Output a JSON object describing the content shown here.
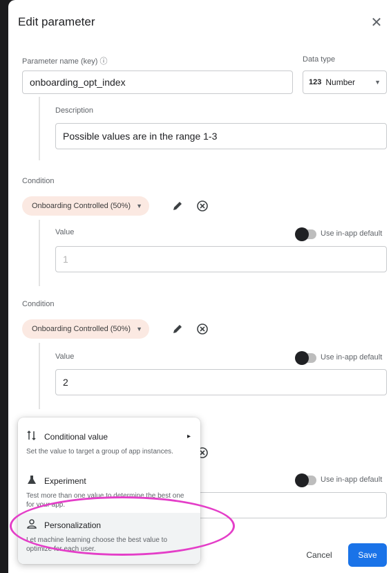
{
  "dialog": {
    "title": "Edit parameter",
    "close_icon": "close-icon"
  },
  "parameter": {
    "key_label": "Parameter name (key)",
    "key_value": "onboarding_opt_index",
    "data_type_label": "Data type",
    "data_type_value": "Number",
    "description_label": "Description",
    "description_value": "Possible values are in the range 1-3"
  },
  "conditions": [
    {
      "label": "Condition",
      "chip": "Onboarding Controlled (50%)",
      "value_label": "Value",
      "value": "1",
      "value_placeholder_style": "disabled",
      "toggle_label": "Use in-app default"
    },
    {
      "label": "Condition",
      "chip": "Onboarding Controlled (50%)",
      "value_label": "Value",
      "value": "2",
      "toggle_label": "Use in-app default"
    }
  ],
  "third_toggle_label": "Use in-app default",
  "menu": {
    "items": [
      {
        "icon": "conditional-value-icon",
        "title": "Conditional value",
        "desc": "Set the value to target a group of app instances."
      },
      {
        "icon": "experiment-icon",
        "title": "Experiment",
        "desc": "Test more than one value to determine the best one for your app."
      },
      {
        "icon": "personalization-icon",
        "title": "Personalization",
        "desc": "Let machine learning choose the best value to optimize for each user."
      }
    ]
  },
  "footer": {
    "cancel": "Cancel",
    "save": "Save"
  },
  "colors": {
    "accent": "#1a73e8",
    "chip_bg": "#fbe9e2",
    "highlight": "#e43ec8"
  }
}
